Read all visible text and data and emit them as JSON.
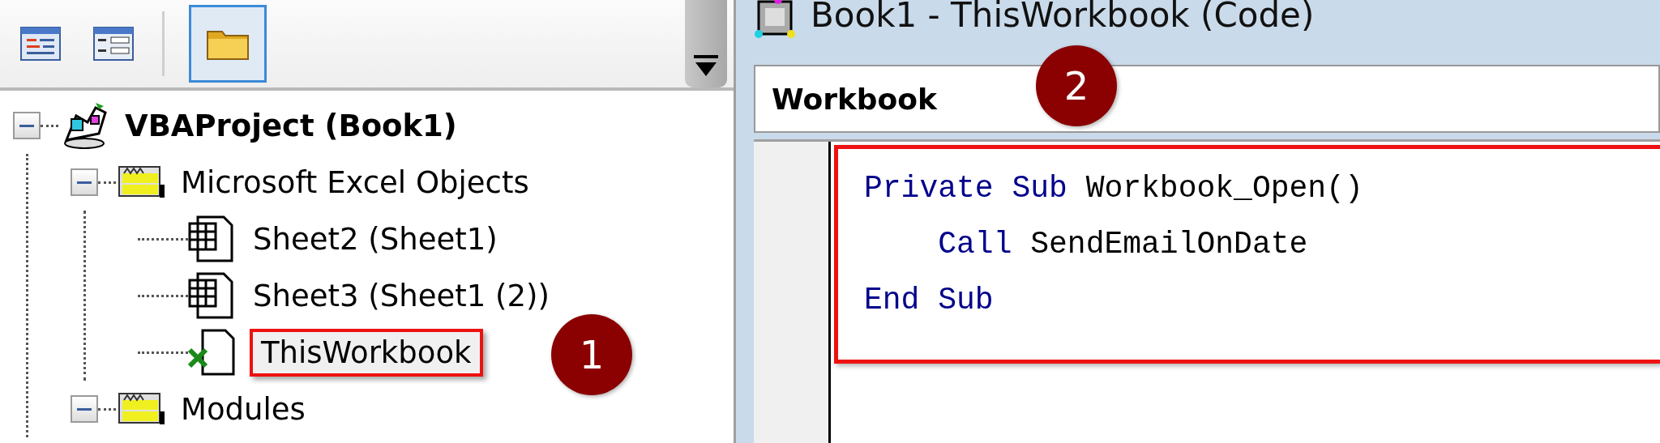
{
  "project_explorer": {
    "toolbar": [
      {
        "kind": "view-code",
        "selected": false
      },
      {
        "kind": "view-object",
        "selected": false
      },
      {
        "kind": "toggle-folders",
        "selected": true
      }
    ],
    "tree": [
      {
        "label": "VBAProject (Book1)",
        "kind": "project",
        "expanded": true,
        "highlighted": false,
        "children": [
          {
            "label": "Microsoft Excel Objects",
            "kind": "folder",
            "expanded": true,
            "highlighted": false,
            "children": [
              {
                "label": "Sheet2 (Sheet1)",
                "kind": "sheet",
                "highlighted": false
              },
              {
                "label": "Sheet3 (Sheet1 (2))",
                "kind": "sheet",
                "highlighted": false
              },
              {
                "label": "ThisWorkbook",
                "kind": "workbook",
                "highlighted": true
              }
            ]
          },
          {
            "label": "Modules",
            "kind": "folder",
            "expanded": true,
            "highlighted": false
          }
        ]
      }
    ]
  },
  "code_window": {
    "title": "Book1 - ThisWorkbook (Code)",
    "object_box": {
      "value": "Workbook"
    },
    "highlighted": true,
    "lines": [
      [
        {
          "text": "Private Sub",
          "kind": "keyword"
        },
        {
          "text": " Workbook_Open()",
          "kind": "plain"
        }
      ],
      [
        {
          "text": "    Call",
          "kind": "keyword"
        },
        {
          "text": " SendEmailOnDate",
          "kind": "plain"
        }
      ],
      [
        {
          "text": "End Sub",
          "kind": "keyword"
        }
      ]
    ]
  },
  "step_badges": [
    {
      "text": "1"
    },
    {
      "text": "2"
    }
  ]
}
